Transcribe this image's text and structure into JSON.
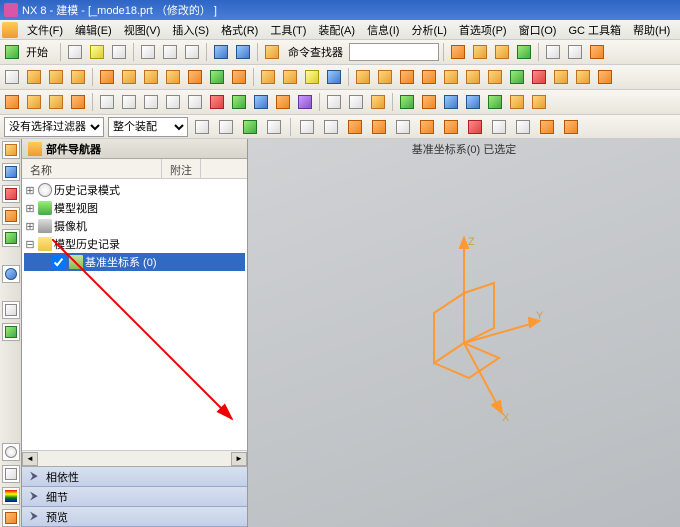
{
  "title": "NX 8 - 建模 - [_mode18.prt （修改的） ]",
  "menu": {
    "file": "文件(F)",
    "edit": "编辑(E)",
    "view": "视图(V)",
    "insert": "插入(S)",
    "format": "格式(R)",
    "tools": "工具(T)",
    "assemblies": "装配(A)",
    "info": "信息(I)",
    "analysis": "分析(L)",
    "preferences": "首选项(P)",
    "window": "窗口(O)",
    "gc": "GC 工具箱",
    "help": "帮助(H)"
  },
  "toolbar1": {
    "start": "开始",
    "cmd_finder": "命令查找器"
  },
  "filter": {
    "sel_filter": "没有选择过滤器",
    "assembly": "整个装配"
  },
  "panel": {
    "title": "部件导航器",
    "col_name": "名称",
    "col_note": "附注"
  },
  "tree": {
    "history_mode": "历史记录模式",
    "model_view": "模型视图",
    "camera": "摄像机",
    "model_history": "模型历史记录",
    "datum_csys": "基准坐标系 (0)"
  },
  "tabs": {
    "dependency": "相依性",
    "detail": "细节",
    "preview": "预览"
  },
  "viewport": {
    "selected": "基准坐标系(0) 已选定",
    "x": "X",
    "y": "Y",
    "z": "Z"
  },
  "chart_data": {
    "type": "other",
    "note": "3D CAD datum coordinate system gizmo with X Y Z axes"
  }
}
